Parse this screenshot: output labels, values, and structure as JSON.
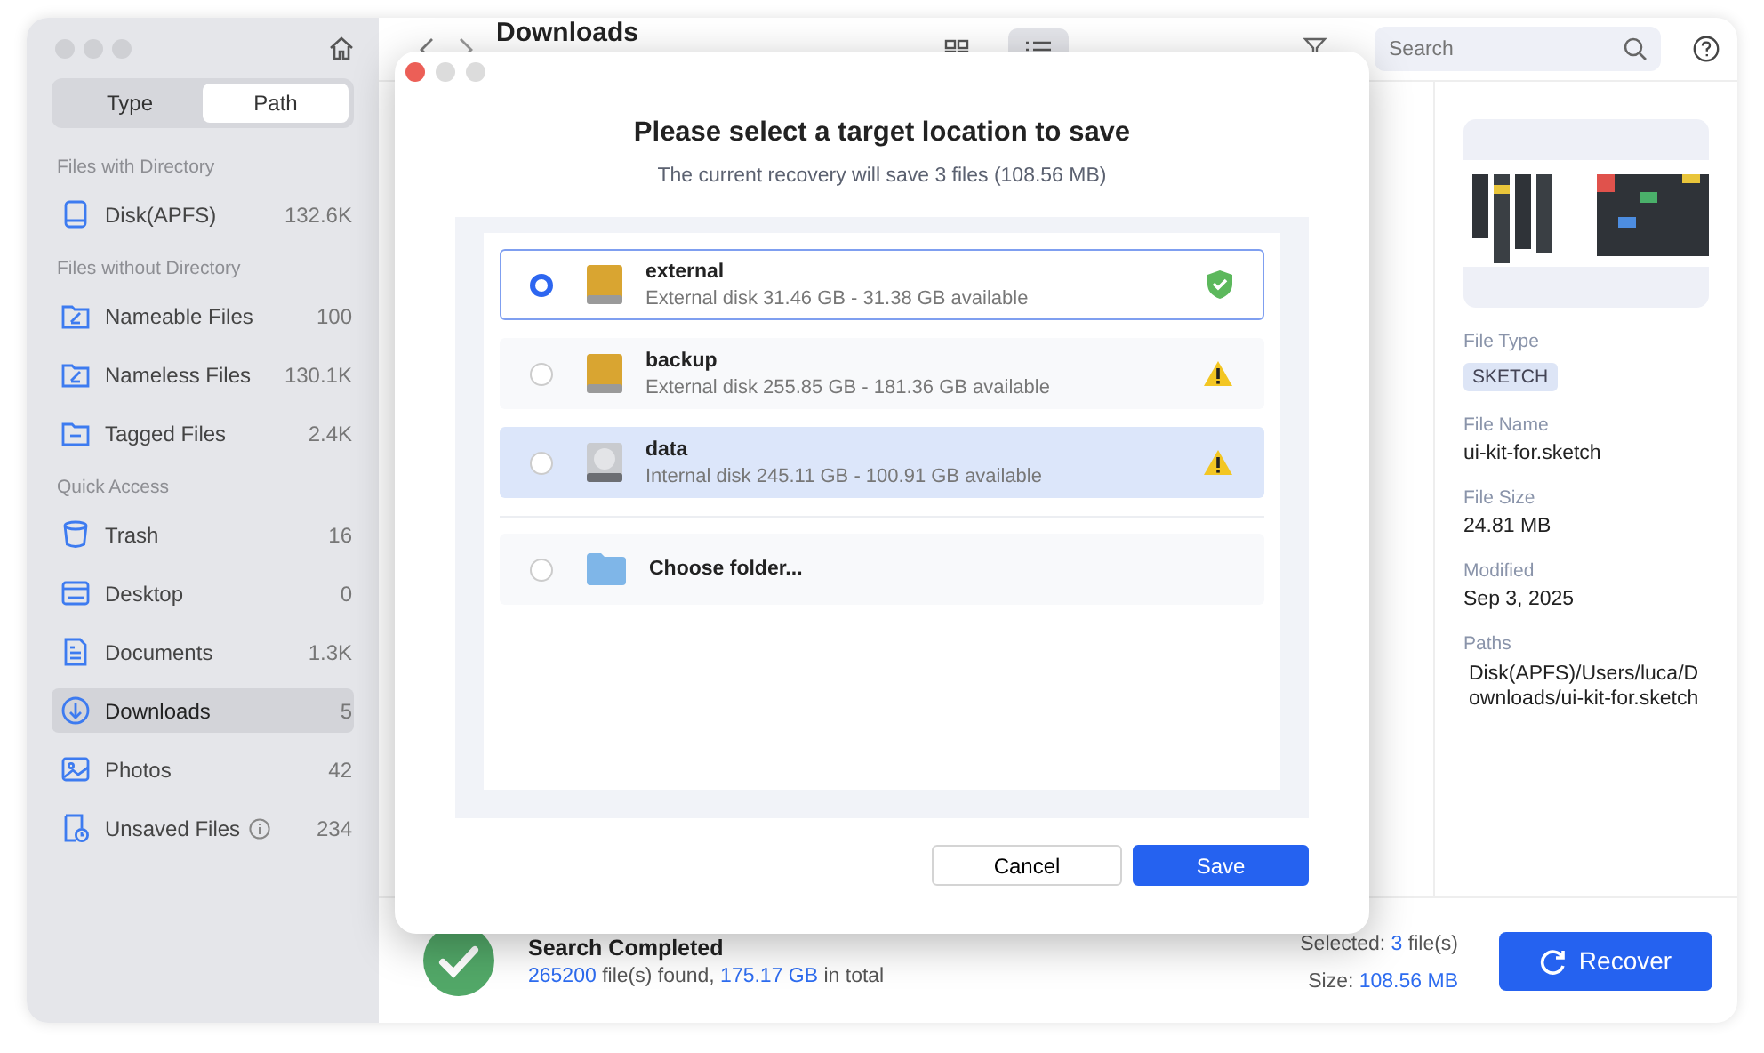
{
  "sidebar": {
    "segments": [
      {
        "label": "Type",
        "selected": false
      },
      {
        "label": "Path",
        "selected": true
      }
    ],
    "sections": [
      {
        "title": "Files with Directory",
        "items": [
          {
            "kind": "disk",
            "label": "Disk(APFS)",
            "count": "132.6K",
            "selected": false,
            "info": false
          }
        ]
      },
      {
        "title": "Files without Directory",
        "items": [
          {
            "kind": "named",
            "label": "Nameable Files",
            "count": "100",
            "selected": false,
            "info": false
          },
          {
            "kind": "named",
            "label": "Nameless Files",
            "count": "130.1K",
            "selected": false,
            "info": false
          },
          {
            "kind": "tagged",
            "label": "Tagged Files",
            "count": "2.4K",
            "selected": false,
            "info": false
          }
        ]
      },
      {
        "title": "Quick Access",
        "items": [
          {
            "kind": "trash",
            "label": "Trash",
            "count": "16",
            "selected": false,
            "info": false
          },
          {
            "kind": "desktop",
            "label": "Desktop",
            "count": "0",
            "selected": false,
            "info": false
          },
          {
            "kind": "documents",
            "label": "Documents",
            "count": "1.3K",
            "selected": false,
            "info": false
          },
          {
            "kind": "downloads",
            "label": "Downloads",
            "count": "5",
            "selected": true,
            "info": false
          },
          {
            "kind": "photos",
            "label": "Photos",
            "count": "42",
            "selected": false,
            "info": false
          },
          {
            "kind": "unsaved",
            "label": "Unsaved Files",
            "count": "234",
            "selected": false,
            "info": true
          }
        ]
      }
    ]
  },
  "toolbar": {
    "title": "Downloads",
    "views": [
      {
        "kind": "grid",
        "selected": false
      },
      {
        "kind": "list",
        "selected": true
      }
    ],
    "search": {
      "placeholder": "Search"
    }
  },
  "details": {
    "fields": [
      {
        "label": "File Type",
        "value": "SKETCH",
        "kind": "tag"
      },
      {
        "label": "File Name",
        "value": "ui-kit-for.sketch",
        "kind": "text"
      },
      {
        "label": "File Size",
        "value": "24.81 MB",
        "kind": "text"
      },
      {
        "label": "Modified",
        "value": "Sep 3, 2025",
        "kind": "text"
      },
      {
        "label": "Paths",
        "value": "Disk(APFS)/Users/luca/Downloads/ui-kit-for.sketch",
        "kind": "path"
      }
    ]
  },
  "status": {
    "title": "Search Completed",
    "summary": [
      {
        "text": "265200",
        "accent": true
      },
      {
        "text": " file(s) found, ",
        "accent": false
      },
      {
        "text": "175.17 GB",
        "accent": true
      },
      {
        "text": " in total",
        "accent": false
      }
    ],
    "selected": [
      {
        "text": "Selected: ",
        "accent": false
      },
      {
        "text": "3",
        "accent": true
      },
      {
        "text": " file(s)",
        "accent": false
      }
    ],
    "size": [
      {
        "text": "Size: ",
        "accent": false
      },
      {
        "text": "108.56 MB",
        "accent": true
      }
    ],
    "button": "Recover"
  },
  "dialog": {
    "title": "Please select a target location to save",
    "subtitle": "The current recovery will save 3 files (108.56 MB)",
    "destinations": [
      {
        "kind": "external",
        "name": "external",
        "detail": "External disk 31.46 GB - 31.38 GB available",
        "selected": true,
        "highlighted": false,
        "warning": false
      },
      {
        "kind": "external",
        "name": "backup",
        "detail": "External disk 255.85 GB - 181.36 GB available",
        "selected": false,
        "highlighted": false,
        "warning": true
      },
      {
        "kind": "internal",
        "name": "data",
        "detail": "Internal disk 245.11 GB - 100.91 GB available",
        "selected": false,
        "highlighted": true,
        "warning": true
      },
      {
        "kind": "folder",
        "name": "Choose folder...",
        "selected": false,
        "highlighted": false
      }
    ],
    "buttons": [
      {
        "label": "Cancel",
        "kind": "secondary"
      },
      {
        "label": "Save",
        "kind": "primary"
      }
    ]
  }
}
